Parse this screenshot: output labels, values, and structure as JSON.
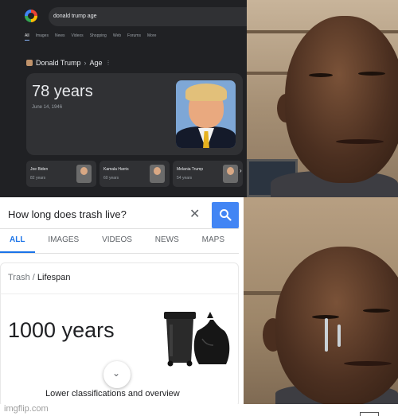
{
  "panel1": {
    "search_query": "donald trump age",
    "tabs": [
      "All",
      "Images",
      "News",
      "Videos",
      "Shopping",
      "Web",
      "Forums",
      "More"
    ],
    "entity": "Donald Trump",
    "attribute": "Age",
    "age_value": "78 years",
    "birth_date": "June 14, 1946",
    "people": [
      {
        "name": "Joe Biden",
        "age": "82 years"
      },
      {
        "name": "Kamala Harris",
        "age": "60 years"
      },
      {
        "name": "Melania Trump",
        "age": "54 years"
      }
    ]
  },
  "panel3": {
    "search_query": "How long does trash live?",
    "tabs": [
      "ALL",
      "IMAGES",
      "VIDEOS",
      "NEWS",
      "MAPS"
    ],
    "crumb_entity": "Trash",
    "crumb_attribute": "Lifespan",
    "value": "1000 years",
    "footer_text": "Lower classifications and overview"
  },
  "watermark": "imgflip.com",
  "colors": {
    "dark_bg": "#202124",
    "dark_card": "#303134",
    "google_blue": "#4285f4",
    "link_blue": "#1a73e8"
  }
}
